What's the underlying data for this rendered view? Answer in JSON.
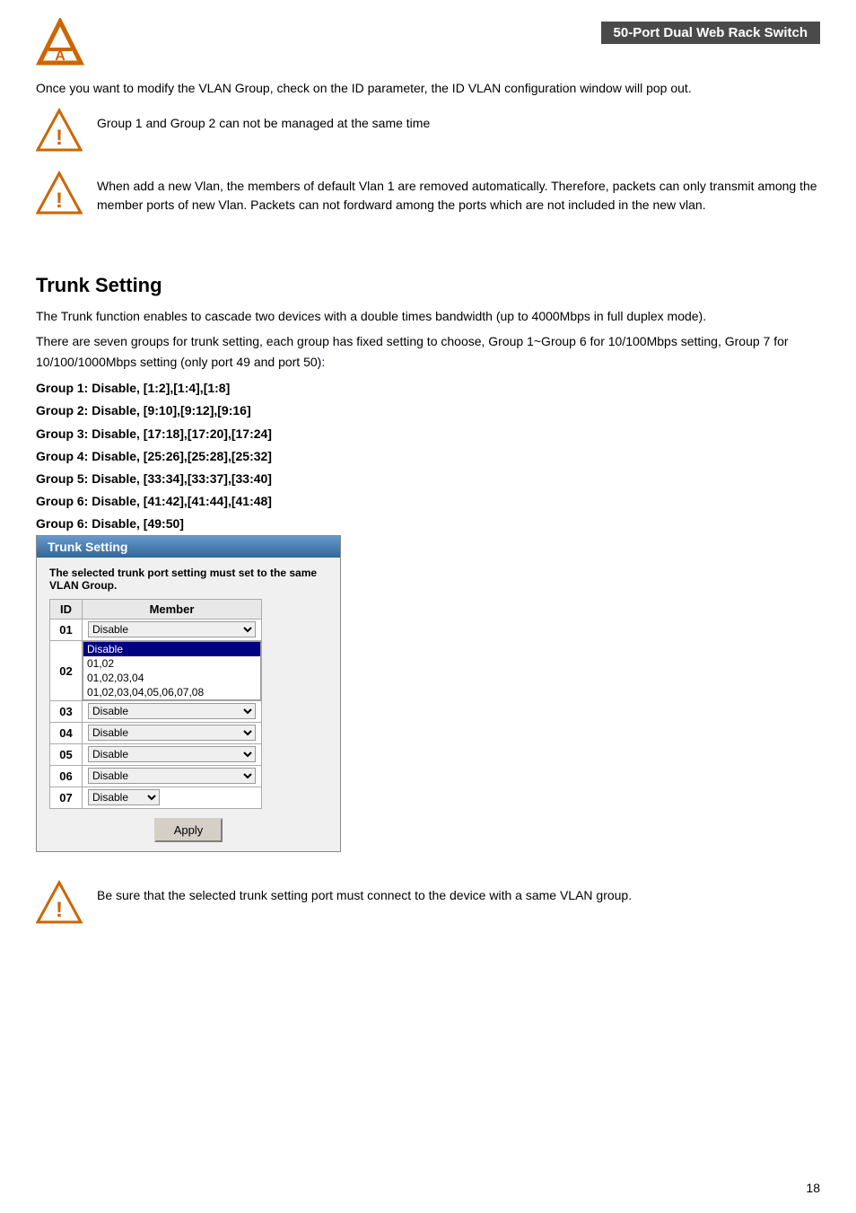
{
  "header": {
    "brand": "50-Port Dual Web Rack Switch"
  },
  "intro": {
    "text": "Once you want to modify the VLAN Group, check on the ID parameter, the ID VLAN configuration window will pop out."
  },
  "warnings": [
    {
      "id": "warning-1",
      "text": "Group 1 and Group 2 can not be managed at the same time"
    },
    {
      "id": "warning-2",
      "text": "When add a new Vlan, the members of default Vlan 1 are removed automatically. Therefore, packets can only transmit among the member ports of new Vlan. Packets can not fordward among the ports which are not included in the new vlan."
    }
  ],
  "trunk_section": {
    "title": "Trunk Setting",
    "desc1": "The Trunk function enables to cascade two devices with a double times bandwidth (up to 4000Mbps in full duplex mode).",
    "desc2_prefix": "There are seven groups for trunk setting, each group has fixed setting to choose, Group 1~Group 6 for 10/100Mbps setting, Group 7 for 10/100/1000Mbps setting (only port 49 and port 50)",
    "desc2_suffix": ":",
    "groups": [
      "Group 1: Disable, [1:2],[1:4],[1:8]",
      "Group 2: Disable, [9:10],[9:12],[9:16]",
      "Group 3: Disable, [17:18],[17:20],[17:24]",
      "Group 4: Disable, [25:26],[25:28],[25:32]",
      "Group 5: Disable, [33:34],[33:37],[33:40]",
      "Group 6: Disable, [41:42],[41:44],[41:48]",
      "Group 6: Disable, [49:50]"
    ]
  },
  "trunk_panel": {
    "title": "Trunk Setting",
    "note": "The selected trunk port setting must set to the same VLAN Group.",
    "table_headers": [
      "ID",
      "Member"
    ],
    "rows": [
      {
        "id": "01",
        "type": "select",
        "value": "Disable",
        "options": [
          "Disable",
          "01,02",
          "01,02,03,04",
          "01,02,03,04,05,06,07,08"
        ]
      },
      {
        "id": "02",
        "type": "expanded",
        "selected": "Disable",
        "options": [
          "Disable",
          "01,02",
          "01,02,03,04",
          "01,02,03,04,05,06,07,08"
        ]
      },
      {
        "id": "03",
        "type": "none",
        "value": ""
      },
      {
        "id": "04",
        "type": "select",
        "value": "Disable",
        "options": [
          "Disable",
          "01,02",
          "01,02,03,04",
          "01,02,03,04,05,06,07,08"
        ]
      },
      {
        "id": "05",
        "type": "select",
        "value": "Disable",
        "options": [
          "Disable",
          "01,02",
          "01,02,03,04",
          "01,02,03,04,05,06,07,08"
        ]
      },
      {
        "id": "06",
        "type": "select",
        "value": "Disable",
        "options": [
          "Disable",
          "01,02",
          "01,02,03,04",
          "01,02,03,04,05,06,07,08"
        ]
      },
      {
        "id": "07",
        "type": "select-small",
        "value": "Disable",
        "options": [
          "Disable"
        ]
      }
    ],
    "apply_label": "Apply"
  },
  "bottom_warning": {
    "text": "Be sure that the selected trunk setting port must connect to the device with a same VLAN group."
  },
  "page_number": "18"
}
